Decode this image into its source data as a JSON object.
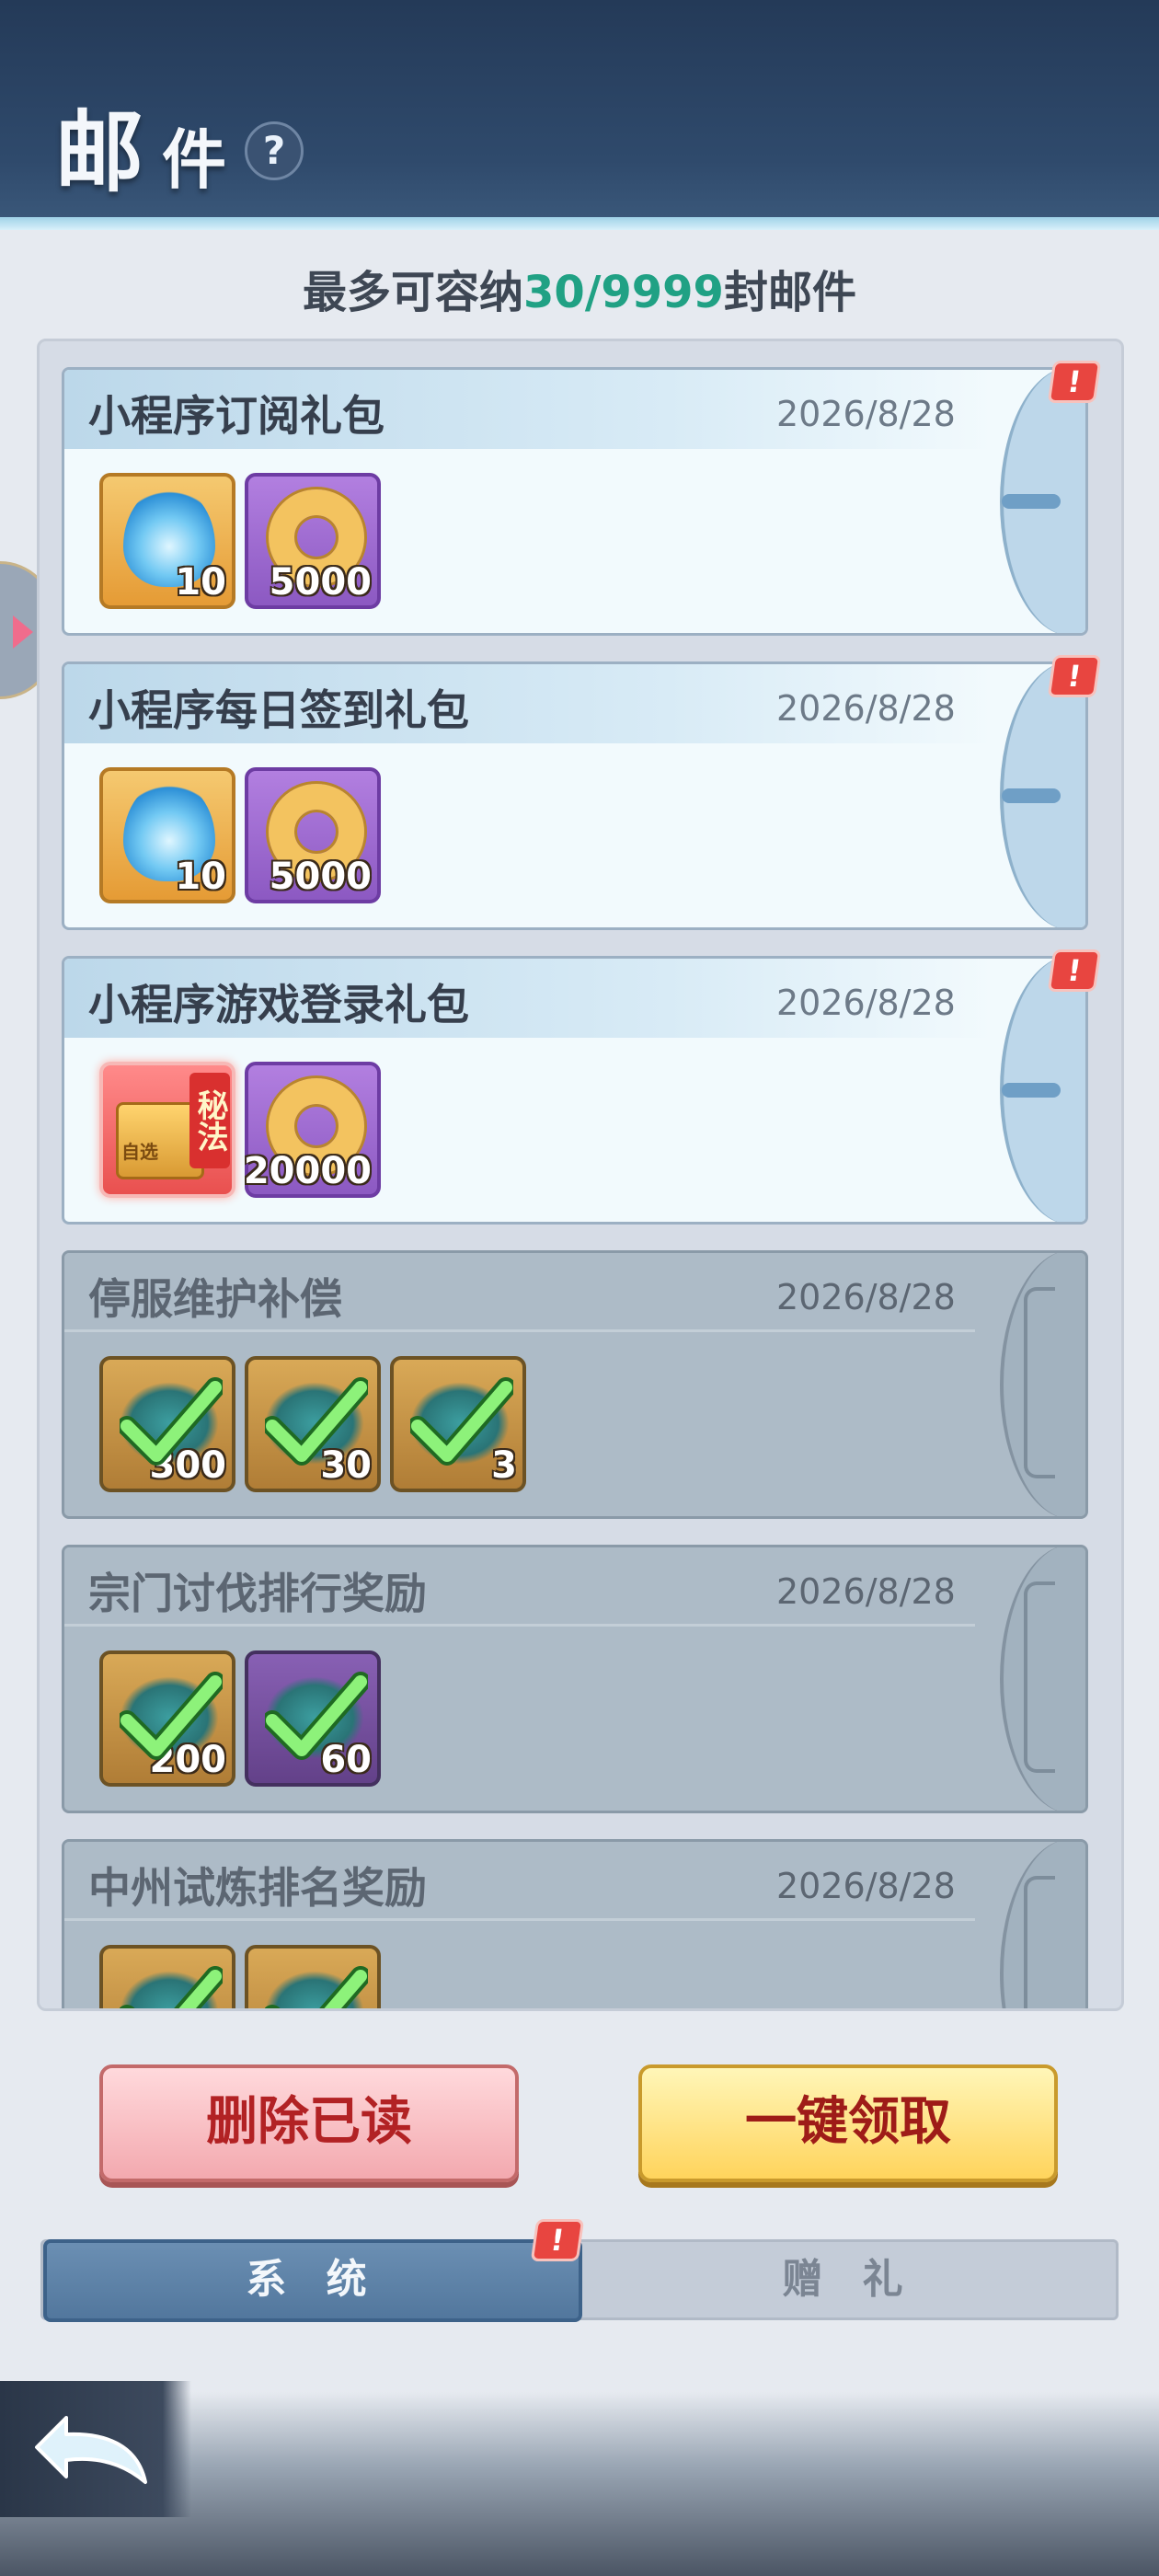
{
  "header": {
    "title_main": "邮",
    "title_sub": "件",
    "help_symbol": "?"
  },
  "capacity": {
    "prefix": "最多可容纳",
    "count": "30/9999",
    "suffix": "封邮件"
  },
  "colors": {
    "accent_green": "#20a184",
    "badge_red": "#e84540",
    "delete_text": "#b22224",
    "claim_bg": "#ffd45c"
  },
  "mails": [
    {
      "title": "小程序订阅礼包",
      "date": "2026/8/28",
      "unread": true,
      "badge": "!",
      "items": [
        {
          "icon": "blue-flame-icon",
          "qty": "10"
        },
        {
          "icon": "gold-ring-icon",
          "qty": "5000"
        }
      ]
    },
    {
      "title": "小程序每日签到礼包",
      "date": "2026/8/28",
      "unread": true,
      "badge": "!",
      "items": [
        {
          "icon": "blue-flame-icon",
          "qty": "10"
        },
        {
          "icon": "gold-ring-icon",
          "qty": "5000"
        }
      ]
    },
    {
      "title": "小程序游戏登录礼包",
      "date": "2026/8/28",
      "unread": true,
      "badge": "!",
      "items": [
        {
          "icon": "secret-method-chest-icon",
          "tag_vertical": "秘法",
          "tag_small": "自选",
          "qty": ""
        },
        {
          "icon": "gold-ring-icon",
          "qty": "20000"
        }
      ]
    },
    {
      "title": "停服维护补偿",
      "date": "2026/8/28",
      "unread": false,
      "items": [
        {
          "icon": "claimed-check-icon",
          "qty": "300"
        },
        {
          "icon": "claimed-check-icon",
          "qty": "30"
        },
        {
          "icon": "claimed-check-icon",
          "qty": "3"
        }
      ]
    },
    {
      "title": "宗门讨伐排行奖励",
      "date": "2026/8/28",
      "unread": false,
      "items": [
        {
          "icon": "claimed-check-icon",
          "qty": "200"
        },
        {
          "icon": "claimed-check-icon",
          "qty": "60"
        }
      ]
    },
    {
      "title": "中州试炼排名奖励",
      "date": "2026/8/28",
      "unread": false,
      "items": [
        {
          "icon": "claimed-check-icon",
          "qty": ""
        },
        {
          "icon": "claimed-check-icon",
          "qty": ""
        }
      ]
    }
  ],
  "buttons": {
    "delete_read": "删除已读",
    "claim_all": "一键领取"
  },
  "tabs": {
    "system": "系 统",
    "gift": "赠 礼",
    "system_badge": "!"
  }
}
